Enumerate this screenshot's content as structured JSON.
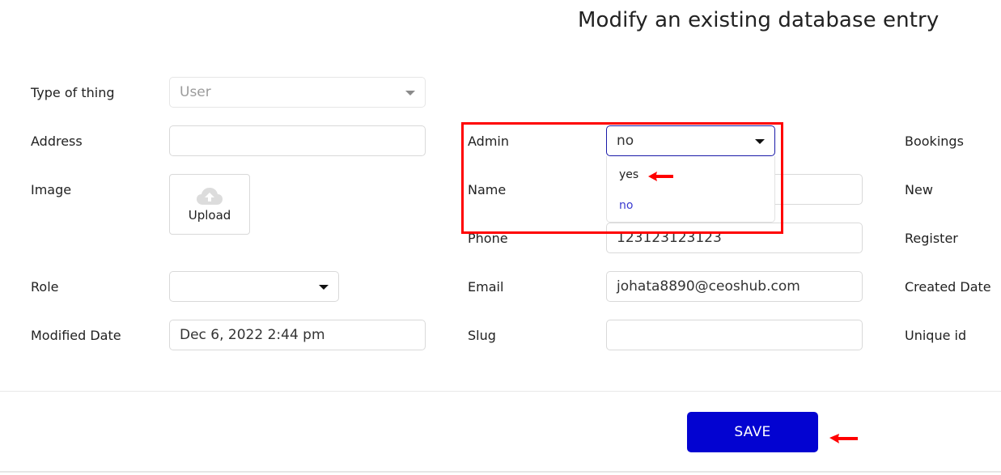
{
  "page": {
    "title": "Modify an existing database entry"
  },
  "form": {
    "left": {
      "type_of_thing": {
        "label": "Type of thing",
        "value": "User",
        "icon": "chevron-down-icon"
      },
      "address": {
        "label": "Address",
        "value": ""
      },
      "image": {
        "label": "Image",
        "upload_label": "Upload",
        "icon": "cloud-upload-icon"
      },
      "role": {
        "label": "Role",
        "value": "",
        "icon": "chevron-down-icon"
      },
      "modified_date": {
        "label": "Modified Date",
        "value": "Dec 6, 2022 2:44 pm"
      }
    },
    "middle": {
      "admin": {
        "label": "Admin",
        "value": "no",
        "icon": "chevron-down-icon",
        "options": [
          "yes",
          "no"
        ],
        "selected_option": "no"
      },
      "name": {
        "label": "Name",
        "value": ""
      },
      "phone": {
        "label": "Phone",
        "value": "123123123123"
      },
      "email": {
        "label": "Email",
        "value": "johata8890@ceoshub.com"
      },
      "slug": {
        "label": "Slug",
        "value": ""
      }
    },
    "right": {
      "labels": [
        "Bookings",
        "New",
        "Register",
        "Created Date",
        "Unique id"
      ]
    }
  },
  "footer": {
    "save_label": "SAVE"
  },
  "colors": {
    "save_button": "#0303d1",
    "annotation": "#ff0000",
    "selected_option": "#3b3bd0",
    "focus_border": "#1a1aa8"
  }
}
